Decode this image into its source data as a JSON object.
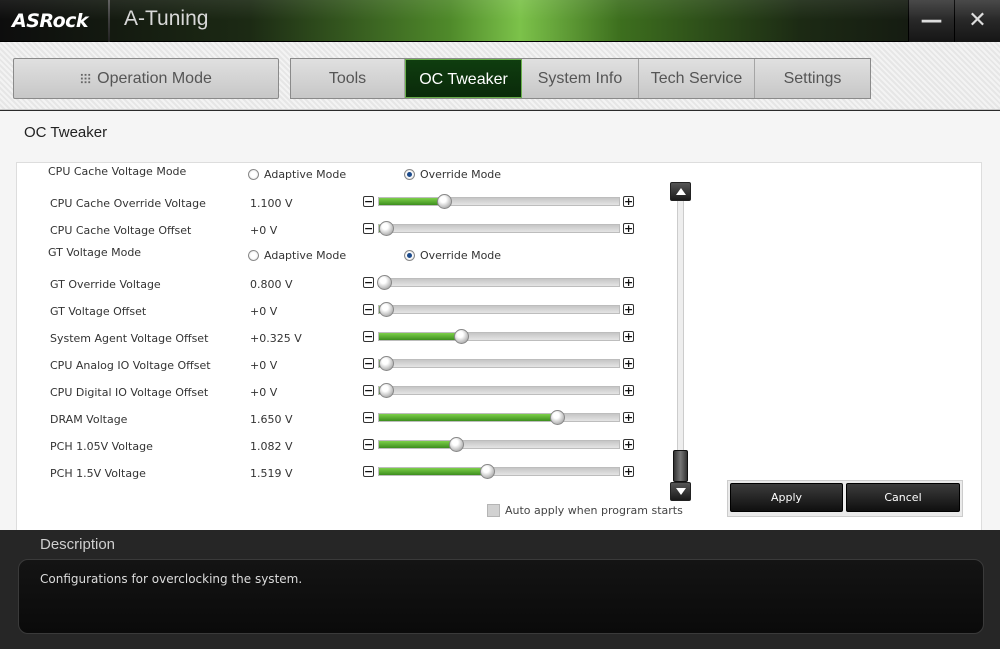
{
  "titlebar": {
    "logo": "ASRock",
    "app_title": "A-Tuning",
    "minimize_glyph": "—",
    "close_glyph": "✕"
  },
  "nav": {
    "operation_mode": "Operation Mode",
    "tabs": [
      {
        "label": "Tools",
        "active": false
      },
      {
        "label": "OC Tweaker",
        "active": true
      },
      {
        "label": "System Info",
        "active": false
      },
      {
        "label": "Tech Service",
        "active": false
      },
      {
        "label": "Settings",
        "active": false
      }
    ]
  },
  "page": {
    "title": "OC Tweaker",
    "modes": {
      "adaptive": "Adaptive Mode",
      "override": "Override Mode"
    },
    "rows": [
      {
        "type": "mode",
        "label": "CPU Cache Voltage Mode",
        "selected": "override"
      },
      {
        "type": "slider",
        "label": "CPU Cache Override Voltage",
        "value": "1.100 V",
        "level": 0.27
      },
      {
        "type": "slider",
        "label": "CPU Cache Voltage Offset",
        "value": "+0 V",
        "level": 0.03
      },
      {
        "type": "mode",
        "label": "GT Voltage Mode",
        "selected": "override"
      },
      {
        "type": "slider",
        "label": "GT Override Voltage",
        "value": "0.800 V",
        "level": 0.02
      },
      {
        "type": "slider",
        "label": "GT Voltage Offset",
        "value": "+0 V",
        "level": 0.03
      },
      {
        "type": "slider",
        "label": "System Agent Voltage Offset",
        "value": "+0.325 V",
        "level": 0.34
      },
      {
        "type": "slider",
        "label": "CPU Analog IO Voltage Offset",
        "value": "+0 V",
        "level": 0.03
      },
      {
        "type": "slider",
        "label": "CPU Digital IO Voltage Offset",
        "value": "+0 V",
        "level": 0.03
      },
      {
        "type": "slider",
        "label": "DRAM Voltage",
        "value": "1.650 V",
        "level": 0.74
      },
      {
        "type": "slider",
        "label": "PCH 1.05V Voltage",
        "value": "1.082 V",
        "level": 0.32
      },
      {
        "type": "slider",
        "label": "PCH 1.5V Voltage",
        "value": "1.519 V",
        "level": 0.45
      }
    ],
    "auto_apply_label": "Auto apply when program starts",
    "apply_label": "Apply",
    "cancel_label": "Cancel"
  },
  "description": {
    "title": "Description",
    "text": "Configurations for overclocking the system."
  },
  "colors": {
    "accent_green": "#3d8e1e",
    "active_tab": "#0f3d0f"
  }
}
